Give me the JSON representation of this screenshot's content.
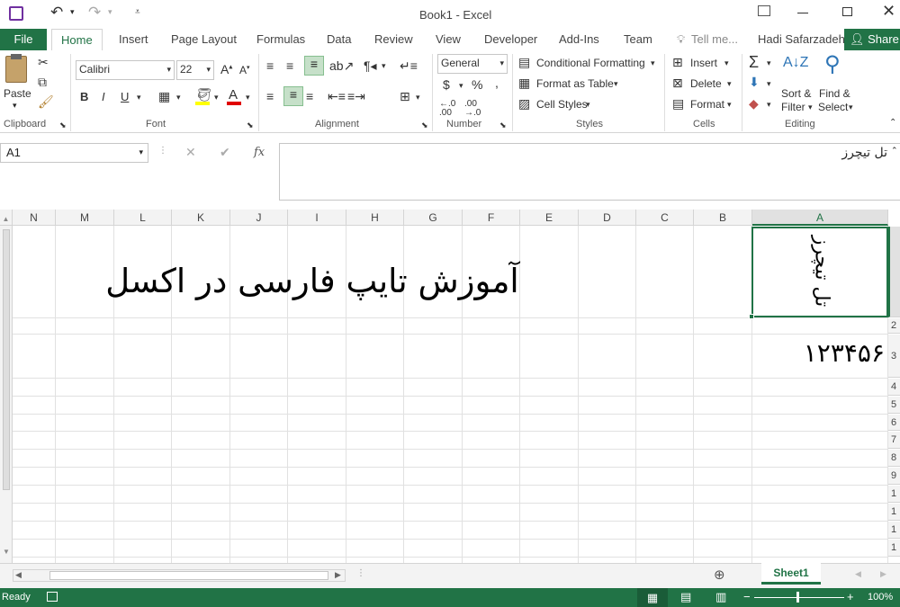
{
  "window": {
    "title": "Book1 - Excel"
  },
  "tabs": {
    "file": "File",
    "home": "Home",
    "insert": "Insert",
    "page_layout": "Page Layout",
    "formulas": "Formulas",
    "data": "Data",
    "review": "Review",
    "view": "View",
    "developer": "Developer",
    "addins": "Add-Ins",
    "team": "Team",
    "tell_me": "Tell me...",
    "user": "Hadi Safarzadeh",
    "share": "Share"
  },
  "ribbon": {
    "clipboard": {
      "label": "Clipboard",
      "paste": "Paste"
    },
    "font": {
      "label": "Font",
      "name": "Calibri",
      "size": "22"
    },
    "alignment": {
      "label": "Alignment"
    },
    "number": {
      "label": "Number",
      "format": "General"
    },
    "styles": {
      "label": "Styles",
      "conditional": "Conditional Formatting",
      "format_table": "Format as Table",
      "cell_styles": "Cell Styles"
    },
    "cells": {
      "label": "Cells",
      "insert": "Insert",
      "delete": "Delete",
      "format": "Format"
    },
    "editing": {
      "label": "Editing",
      "sort1": "Sort &",
      "sort2": "Filter",
      "find1": "Find &",
      "find2": "Select"
    }
  },
  "formula_bar": {
    "name_box": "A1",
    "fx": "fx",
    "content": "تل تیچرز"
  },
  "grid": {
    "columns": [
      "N",
      "M",
      "L",
      "K",
      "J",
      "I",
      "H",
      "G",
      "F",
      "E",
      "D",
      "C",
      "B",
      "A"
    ],
    "rows": [
      "2",
      "3",
      "4",
      "5",
      "6",
      "7",
      "8",
      "9",
      "1",
      "1",
      "1",
      "1"
    ],
    "cell_a1": "تل تیچرز",
    "cell_a3": "۱۲۳۴۵۶",
    "merged_title": "آموزش تایپ فارسی در اکسل"
  },
  "sheet": {
    "tab": "Sheet1"
  },
  "status": {
    "ready": "Ready",
    "zoom": "100%"
  },
  "colors": {
    "accent": "#217346",
    "selection_border": "#217346"
  }
}
